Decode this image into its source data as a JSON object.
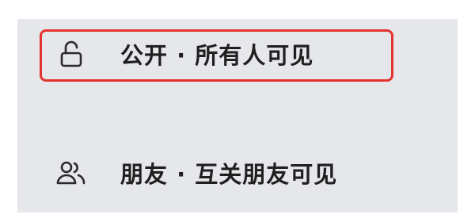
{
  "visibility_menu": {
    "options": [
      {
        "label": "公开 · 所有人可见",
        "icon": "unlock-icon",
        "selected": true
      },
      {
        "label": "朋友 · 互关朋友可见",
        "icon": "friends-icon",
        "selected": false
      }
    ],
    "highlight_color": "#e3342f",
    "panel_color": "#e6e7eb"
  }
}
